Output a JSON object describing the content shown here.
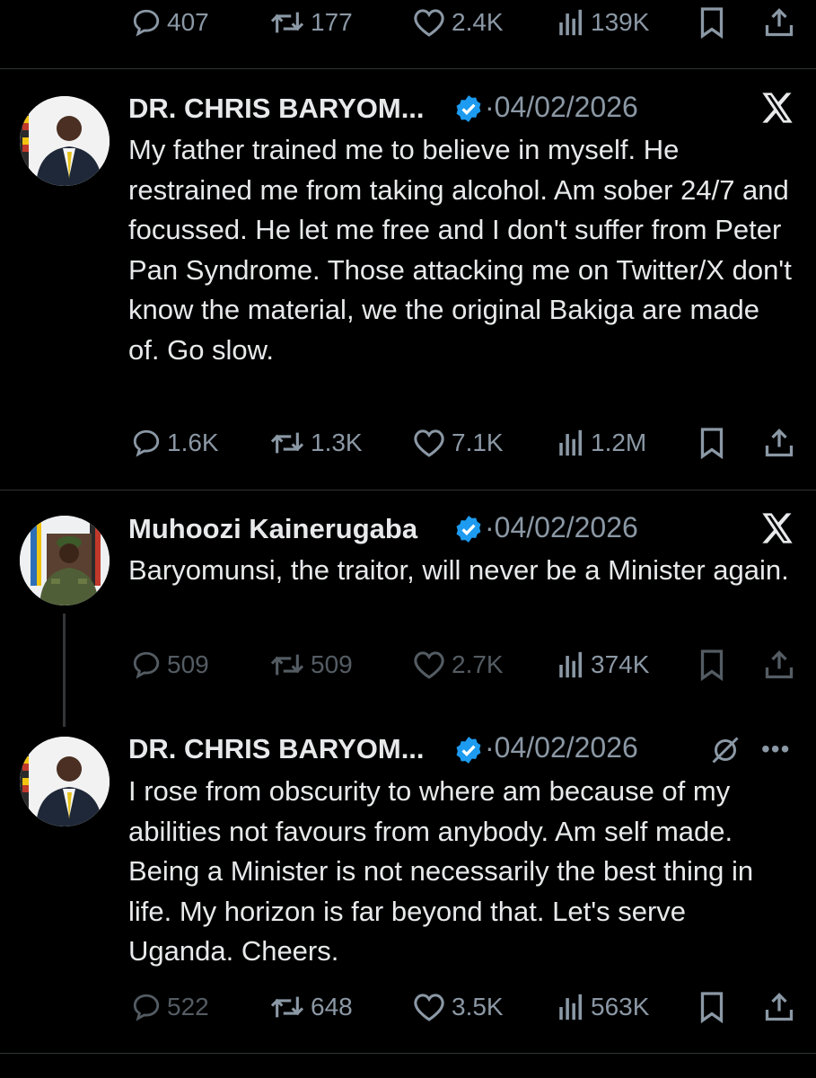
{
  "top_actions": {
    "replies": "407",
    "reposts": "177",
    "likes": "2.4K",
    "views": "139K"
  },
  "tweets": [
    {
      "author": "DR. CHRIS BARYOM...",
      "date": "·04/02/2026",
      "text": "My father trained me to believe in myself. He restrained me from taking alcohol. Am sober 24/7 and focussed. He let me free and  I don't suffer from Peter Pan Syndrome. Those attacking me on Twitter/X don't know the material, we the original Bakiga are made of. Go slow.",
      "replies": "1.6K",
      "reposts": "1.3K",
      "likes": "7.1K",
      "views": "1.2M"
    },
    {
      "author": "Muhoozi Kainerugaba",
      "date": "·04/02/2026",
      "text": "Baryomunsi, the traitor, will never be a Minister again.",
      "replies": "509",
      "reposts": "509",
      "likes": "2.7K",
      "views": "374K"
    },
    {
      "author": "DR. CHRIS BARYOM...",
      "date": "·04/02/2026",
      "text": "I rose from obscurity to where am because of my abilities not favours from anybody. Am self made.  Being a Minister is not necessarily the best thing in life. My horizon is far beyond that. Let's serve Uganda. Cheers.",
      "replies": "522",
      "reposts": "648",
      "likes": "3.5K",
      "views": "563K"
    }
  ],
  "colors": {
    "background": "#000000",
    "text": "#e7e9ea",
    "muted": "#8b98a5",
    "verified": "#1d9bf0",
    "divider": "#2f3336"
  },
  "icons": [
    "reply-icon",
    "repost-icon",
    "like-icon",
    "views-icon",
    "bookmark-icon",
    "share-icon",
    "verified-badge-icon",
    "x-logo-icon",
    "grok-icon",
    "more-icon"
  ]
}
